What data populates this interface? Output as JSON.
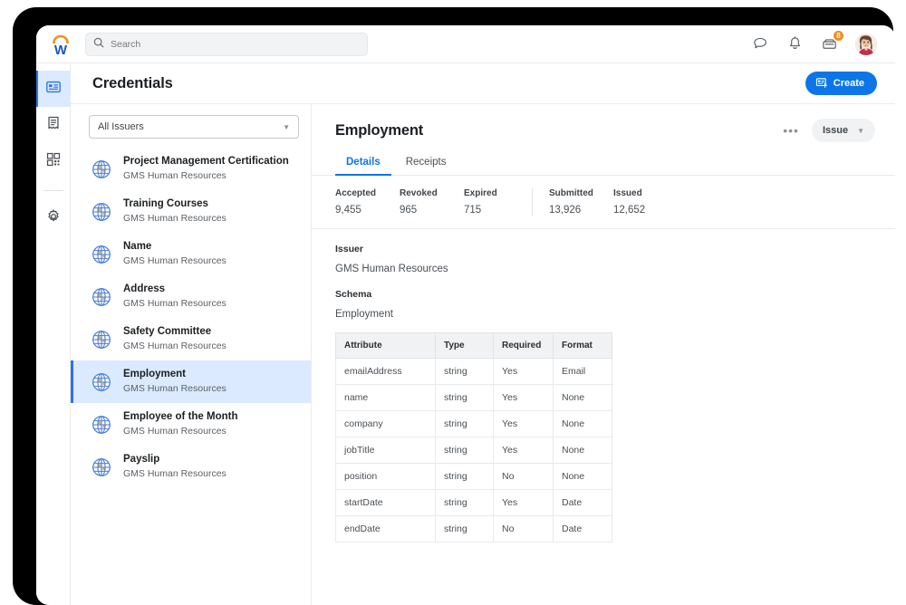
{
  "brand": {
    "logo_letter": "W",
    "accent_orange": "#f68c1f",
    "accent_blue": "#0c76e8"
  },
  "topbar": {
    "search_placeholder": "Search",
    "search_value": "",
    "icons": [
      "chat-icon",
      "bell-icon",
      "inbox-icon",
      "avatar"
    ],
    "inbox_badge": "8"
  },
  "rail": {
    "items": [
      {
        "name": "credentials-icon",
        "active": true
      },
      {
        "name": "receipts-icon",
        "active": false
      },
      {
        "name": "qr-code-icon",
        "active": false
      },
      {
        "name": "settings-gear-icon",
        "active": false
      }
    ]
  },
  "page": {
    "title": "Credentials",
    "create_label": "Create"
  },
  "list": {
    "filter_value": "All Issuers",
    "items": [
      {
        "name": "Project Management Certification",
        "issuer": "GMS Human Resources",
        "selected": false
      },
      {
        "name": "Training Courses",
        "issuer": "GMS Human Resources",
        "selected": false
      },
      {
        "name": "Name",
        "issuer": "GMS Human Resources",
        "selected": false
      },
      {
        "name": "Address",
        "issuer": "GMS Human Resources",
        "selected": false
      },
      {
        "name": "Safety Committee",
        "issuer": "GMS Human Resources",
        "selected": false
      },
      {
        "name": "Employment",
        "issuer": "GMS Human Resources",
        "selected": true
      },
      {
        "name": "Employee of the Month",
        "issuer": "GMS Human Resources",
        "selected": false
      },
      {
        "name": "Payslip",
        "issuer": "GMS Human Resources",
        "selected": false
      }
    ]
  },
  "detail": {
    "title": "Employment",
    "overflow_label": "•••",
    "issue_label": "Issue",
    "tabs": [
      {
        "label": "Details",
        "active": true
      },
      {
        "label": "Receipts",
        "active": false
      }
    ],
    "stats": [
      {
        "label": "Accepted",
        "value": "9,455"
      },
      {
        "label": "Revoked",
        "value": "965"
      },
      {
        "label": "Expired",
        "value": "715"
      },
      {
        "label": "Submitted",
        "value": "13,926"
      },
      {
        "label": "Issued",
        "value": "12,652"
      }
    ],
    "issuer_label": "Issuer",
    "issuer_value": "GMS Human Resources",
    "schema_label": "Schema",
    "schema_value": "Employment",
    "table": {
      "columns": [
        "Attribute",
        "Type",
        "Required",
        "Format"
      ],
      "rows": [
        [
          "emailAddress",
          "string",
          "Yes",
          "Email"
        ],
        [
          "name",
          "string",
          "Yes",
          "None"
        ],
        [
          "company",
          "string",
          "Yes",
          "None"
        ],
        [
          "jobTitle",
          "string",
          "Yes",
          "None"
        ],
        [
          "position",
          "string",
          "No",
          "None"
        ],
        [
          "startDate",
          "string",
          "Yes",
          "Date"
        ],
        [
          "endDate",
          "string",
          "No",
          "Date"
        ]
      ]
    }
  }
}
